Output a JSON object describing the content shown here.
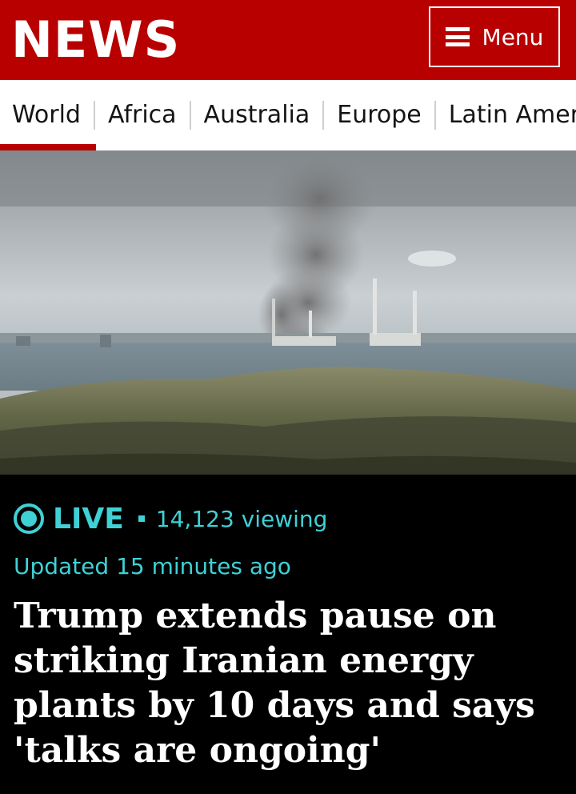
{
  "header": {
    "logo": "NEWS",
    "menu_label": "Menu",
    "brand_color": "#b80000"
  },
  "nav": {
    "items": [
      {
        "label": "World",
        "active": true
      },
      {
        "label": "Africa"
      },
      {
        "label": "Australia"
      },
      {
        "label": "Europe"
      },
      {
        "label": "Latin America"
      }
    ]
  },
  "hero": {
    "icon": "hero-photo-smoke-over-power-plant"
  },
  "live": {
    "label": "LIVE",
    "viewing": "14,123 viewing",
    "updated": "Updated 15 minutes ago",
    "accent_color": "#3fd1d6"
  },
  "article": {
    "headline": "Trump extends pause on striking Iranian energy plants by 10 days and says 'talks are ongoing'"
  }
}
